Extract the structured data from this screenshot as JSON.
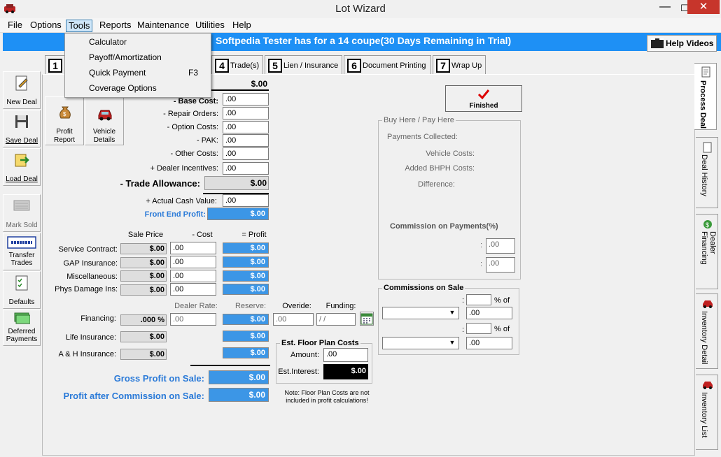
{
  "window": {
    "title": "Lot Wizard"
  },
  "menu": [
    "File",
    "Options",
    "Tools",
    "Reports",
    "Maintenance",
    "Utilities",
    "Help"
  ],
  "tools_menu": {
    "items": [
      {
        "label": "Calculator",
        "shortcut": ""
      },
      {
        "label": "Payoff/Amortization",
        "shortcut": ""
      },
      {
        "label": "Quick Payment",
        "shortcut": "F3"
      },
      {
        "label": "Coverage Options",
        "shortcut": ""
      }
    ]
  },
  "banner": {
    "text": "Softpedia Tester has  for a 14  coupe(30 Days Remaining in Trial)",
    "help_videos": "Help Videos"
  },
  "sidebar": {
    "new_deal": "New Deal",
    "save_deal": "Save Deal",
    "load_deal": "Load Deal",
    "mark_sold": "Mark Sold",
    "transfer_trades": "Transfer Trades",
    "defaults": "Defaults",
    "deferred_payments": "Deferred Payments"
  },
  "subtools": {
    "profit_report": "Profit Report",
    "vehicle_details": "Vehicle Details"
  },
  "tabs": [
    {
      "num": "1",
      "label": ""
    },
    {
      "num": "4",
      "label": "Trade(s)"
    },
    {
      "num": "5",
      "label": "Lien / Insurance"
    },
    {
      "num": "6",
      "label": "Document Printing"
    },
    {
      "num": "7",
      "label": "Wrap Up"
    }
  ],
  "right_tabs": [
    "Process Deal",
    "Deal History",
    "Dealer Financing",
    "Inventory Detail",
    "Inventory List"
  ],
  "finished_button": "Finished",
  "cost": {
    "top_total": "$.00",
    "rows": [
      {
        "label": "- Base Cost:",
        "value": ".00"
      },
      {
        "label": "- Repair Orders:",
        "value": ".00"
      },
      {
        "label": "- Option Costs:",
        "value": ".00"
      },
      {
        "label": "- PAK:",
        "value": ".00"
      },
      {
        "label": "- Other Costs:",
        "value": ".00"
      },
      {
        "label": "+ Dealer Incentives:",
        "value": ".00"
      }
    ],
    "trade_allowance_label": "- Trade Allowance:",
    "trade_allowance_value": "$.00",
    "acv_label": "+ Actual Cash Value:",
    "acv_value": ".00",
    "front_end_label": "Front End Profit:",
    "front_end_value": "$.00"
  },
  "products": {
    "headers": {
      "sale_price": "Sale Price",
      "cost": "- Cost",
      "profit": "= Profit"
    },
    "rows": [
      {
        "label": "Service Contract:",
        "price": "$.00",
        "cost": ".00",
        "profit": "$.00"
      },
      {
        "label": "GAP Insurance:",
        "price": "$.00",
        "cost": ".00",
        "profit": "$.00"
      },
      {
        "label": "Miscellaneous:",
        "price": "$.00",
        "cost": ".00",
        "profit": "$.00"
      },
      {
        "label": "Phys Damage Ins:",
        "price": "$.00",
        "cost": ".00",
        "profit": "$.00"
      }
    ]
  },
  "financing": {
    "headers": {
      "dealer_rate": "Dealer Rate:",
      "reserve": "Reserve:",
      "overide": "Overide:",
      "funding": "Funding:"
    },
    "label": "Financing:",
    "rate": ".000 %",
    "dealer_rate": ".00",
    "reserve": "$.00",
    "overide": ".00",
    "funding": " /  /",
    "life_label": "Life Insurance:",
    "life_price": "$.00",
    "life_profit": "$.00",
    "ah_label": "A & H Insurance:",
    "ah_price": "$.00",
    "ah_profit": "$.00"
  },
  "totals": {
    "gross_label": "Gross Profit on Sale:",
    "gross_value": "$.00",
    "after_comm_label": "Profit after Commission on Sale:",
    "after_comm_value": "$.00"
  },
  "floor_plan": {
    "title": "Est. Floor Plan Costs",
    "amount_label": "Amount:",
    "amount_value": ".00",
    "interest_label": "Est.Interest:",
    "interest_value": "$.00",
    "note": "Note: Floor Plan Costs are not included in profit calculations!"
  },
  "bhph": {
    "title": "Buy Here / Pay Here",
    "payments": "Payments Collected:",
    "vehicle_costs": "Vehicle Costs:",
    "added_costs": "Added BHPH Costs:",
    "difference": "Difference:",
    "commission_title": "Commission on Payments(%)",
    "colon": ":",
    "comm1": ".00",
    "comm2": ".00"
  },
  "commissions": {
    "title": "Commissions on Sale",
    "pct_of": "% of",
    "colon": ":",
    "value1": ".00",
    "value2": ".00"
  },
  "colors": {
    "banner": "#1e90f5",
    "profit_field": "#3c96e6",
    "close": "#c7352b"
  }
}
